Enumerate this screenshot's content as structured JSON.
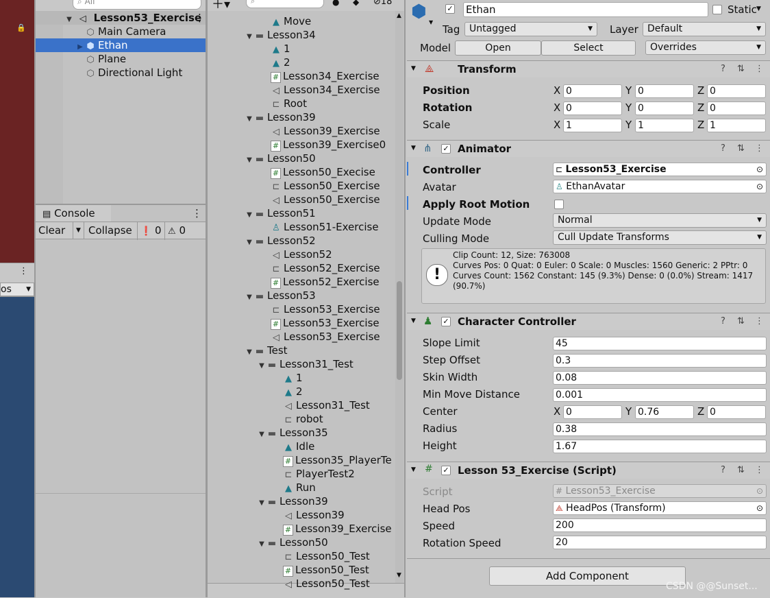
{
  "scene_left": {
    "colors": {
      "top": "#6a2323",
      "bottom": "#2b4a72"
    },
    "partial_label": "os"
  },
  "hierarchy": {
    "search_placeholder": "All",
    "scene_name": "Lesson53_Exercise",
    "items": [
      {
        "label": "Main Camera",
        "icon": "cube-icon"
      },
      {
        "label": "Ethan",
        "icon": "prefab-icon",
        "selected": true
      },
      {
        "label": "Plane",
        "icon": "cube-icon"
      },
      {
        "label": "Directional Light",
        "icon": "cube-icon"
      }
    ]
  },
  "console": {
    "tab_label": "Console",
    "clear_label": "Clear",
    "collapse_label": "Collapse",
    "info_count": "0",
    "warn_count": "0"
  },
  "project": {
    "search_count": "18",
    "items": [
      {
        "label": "Move",
        "indent": 2,
        "icon": "anim"
      },
      {
        "label": "Lesson34",
        "indent": 1,
        "icon": "folder",
        "fold": true
      },
      {
        "label": "1",
        "indent": 2,
        "icon": "anim"
      },
      {
        "label": "2",
        "indent": 2,
        "icon": "anim"
      },
      {
        "label": "Lesson34_Exercise",
        "indent": 2,
        "icon": "script"
      },
      {
        "label": "Lesson34_Exercise",
        "indent": 2,
        "icon": "unity"
      },
      {
        "label": "Root",
        "indent": 2,
        "icon": "controller"
      },
      {
        "label": "Lesson39",
        "indent": 1,
        "icon": "folder",
        "fold": true
      },
      {
        "label": "Lesson39_Exercise",
        "indent": 2,
        "icon": "unity"
      },
      {
        "label": "Lesson39_Exercise0",
        "indent": 2,
        "icon": "script"
      },
      {
        "label": "Lesson50",
        "indent": 1,
        "icon": "folder",
        "fold": true
      },
      {
        "label": "Lesson50_Execise",
        "indent": 2,
        "icon": "script"
      },
      {
        "label": "Lesson50_Exercise",
        "indent": 2,
        "icon": "controller"
      },
      {
        "label": "Lesson50_Exercise",
        "indent": 2,
        "icon": "unity"
      },
      {
        "label": "Lesson51",
        "indent": 1,
        "icon": "folder",
        "fold": true
      },
      {
        "label": "Lesson51-Exercise",
        "indent": 2,
        "icon": "avatar"
      },
      {
        "label": "Lesson52",
        "indent": 1,
        "icon": "folder",
        "fold": true
      },
      {
        "label": "Lesson52",
        "indent": 2,
        "icon": "unity"
      },
      {
        "label": "Lesson52_Exercise",
        "indent": 2,
        "icon": "controller"
      },
      {
        "label": "Lesson52_Exercise",
        "indent": 2,
        "icon": "script"
      },
      {
        "label": "Lesson53",
        "indent": 1,
        "icon": "folder",
        "fold": true
      },
      {
        "label": "Lesson53_Exercise",
        "indent": 2,
        "icon": "controller"
      },
      {
        "label": "Lesson53_Exercise",
        "indent": 2,
        "icon": "script"
      },
      {
        "label": "Lesson53_Exercise",
        "indent": 2,
        "icon": "unity"
      },
      {
        "label": "Test",
        "indent": 1,
        "icon": "folder",
        "fold": true
      },
      {
        "label": "Lesson31_Test",
        "indent": 2,
        "icon": "folder",
        "fold": true
      },
      {
        "label": "1",
        "indent": 3,
        "icon": "anim"
      },
      {
        "label": "2",
        "indent": 3,
        "icon": "anim"
      },
      {
        "label": "Lesson31_Test",
        "indent": 3,
        "icon": "unity"
      },
      {
        "label": "robot",
        "indent": 3,
        "icon": "controller"
      },
      {
        "label": "Lesson35",
        "indent": 2,
        "icon": "folder",
        "fold": true
      },
      {
        "label": "Idle",
        "indent": 3,
        "icon": "anim"
      },
      {
        "label": "Lesson35_PlayerTe",
        "indent": 3,
        "icon": "script"
      },
      {
        "label": "PlayerTest2",
        "indent": 3,
        "icon": "controller"
      },
      {
        "label": "Run",
        "indent": 3,
        "icon": "anim"
      },
      {
        "label": "Lesson39",
        "indent": 2,
        "icon": "folder",
        "fold": true
      },
      {
        "label": "Lesson39",
        "indent": 3,
        "icon": "unity"
      },
      {
        "label": "Lesson39_Exercise",
        "indent": 3,
        "icon": "script"
      },
      {
        "label": "Lesson50",
        "indent": 2,
        "icon": "folder",
        "fold": true
      },
      {
        "label": "Lesson50_Test",
        "indent": 3,
        "icon": "controller"
      },
      {
        "label": "Lesson50_Test",
        "indent": 3,
        "icon": "script"
      },
      {
        "label": "Lesson50_Test",
        "indent": 3,
        "icon": "unity"
      }
    ]
  },
  "inspector": {
    "object_name": "Ethan",
    "static_label": "Static",
    "tag_label": "Tag",
    "tag_value": "Untagged",
    "layer_label": "Layer",
    "layer_value": "Default",
    "model_label": "Model",
    "open_label": "Open",
    "select_label": "Select",
    "overrides_label": "Overrides",
    "transform": {
      "title": "Transform",
      "position_label": "Position",
      "rotation_label": "Rotation",
      "scale_label": "Scale",
      "position": [
        "0",
        "0",
        "0"
      ],
      "rotation": [
        "0",
        "0",
        "0"
      ],
      "scale": [
        "1",
        "1",
        "1"
      ]
    },
    "animator": {
      "title": "Animator",
      "controller_label": "Controller",
      "controller_value": "Lesson53_Exercise",
      "avatar_label": "Avatar",
      "avatar_value": "EthanAvatar",
      "apply_root_label": "Apply Root Motion",
      "update_mode_label": "Update Mode",
      "update_mode_value": "Normal",
      "culling_mode_label": "Culling Mode",
      "culling_mode_value": "Cull Update Transforms",
      "info_line1": "Clip Count: 12, Size: 763008",
      "info_line2": "Curves Pos: 0 Quat: 0 Euler: 0 Scale: 0 Muscles: 1560 Generic: 2 PPtr: 0",
      "info_line3": "Curves Count: 1562 Constant: 145 (9.3%) Dense: 0 (0.0%) Stream: 1417",
      "info_line4": "(90.7%)"
    },
    "character_controller": {
      "title": "Character Controller",
      "slope_limit_label": "Slope Limit",
      "slope_limit": "45",
      "step_offset_label": "Step Offset",
      "step_offset": "0.3",
      "skin_width_label": "Skin Width",
      "skin_width": "0.08",
      "min_move_label": "Min Move Distance",
      "min_move": "0.001",
      "center_label": "Center",
      "center": [
        "0",
        "0.76",
        "0"
      ],
      "radius_label": "Radius",
      "radius": "0.38",
      "height_label": "Height",
      "height": "1.67"
    },
    "script_comp": {
      "title": "Lesson 53_Exercise (Script)",
      "script_label": "Script",
      "script_value": "Lesson53_Exercise",
      "head_pos_label": "Head Pos",
      "head_pos_value": "HeadPos (Transform)",
      "speed_label": "Speed",
      "speed": "200",
      "rotation_speed_label": "Rotation Speed",
      "rotation_speed": "20"
    },
    "add_component_label": "Add Component"
  },
  "watermark": "CSDN @@Sunset..."
}
